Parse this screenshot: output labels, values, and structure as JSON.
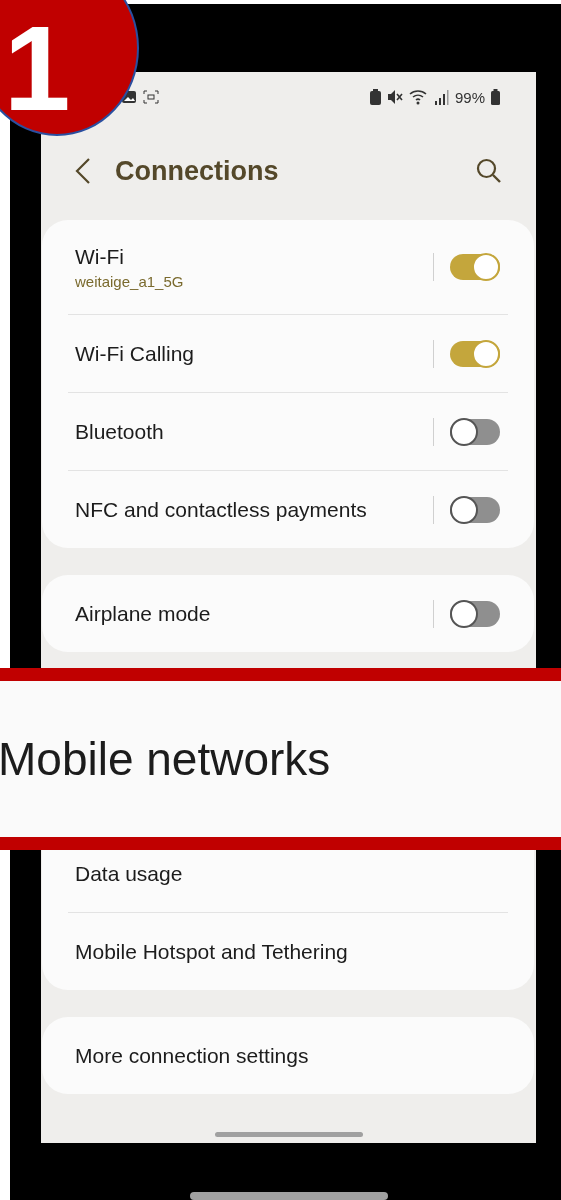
{
  "badge": {
    "number": "1"
  },
  "status_bar": {
    "battery": "99%"
  },
  "header": {
    "title": "Connections"
  },
  "groups": [
    {
      "items": [
        {
          "kind": "toggle",
          "title": "Wi-Fi",
          "subtitle": "weitaige_a1_5G",
          "on": true
        },
        {
          "kind": "toggle",
          "title": "Wi-Fi Calling",
          "on": true
        },
        {
          "kind": "toggle",
          "title": "Bluetooth",
          "on": false
        },
        {
          "kind": "toggle",
          "title": "NFC and contactless payments",
          "on": false
        }
      ]
    },
    {
      "items": [
        {
          "kind": "toggle",
          "title": "Airplane mode",
          "on": false
        }
      ]
    },
    {
      "callout": {
        "text": "Mobile networks"
      },
      "items": [
        {
          "kind": "link",
          "title": "Data usage"
        },
        {
          "kind": "link",
          "title": "Mobile Hotspot and Tethering"
        }
      ]
    },
    {
      "items": [
        {
          "kind": "link",
          "title": "More connection settings"
        }
      ]
    }
  ]
}
